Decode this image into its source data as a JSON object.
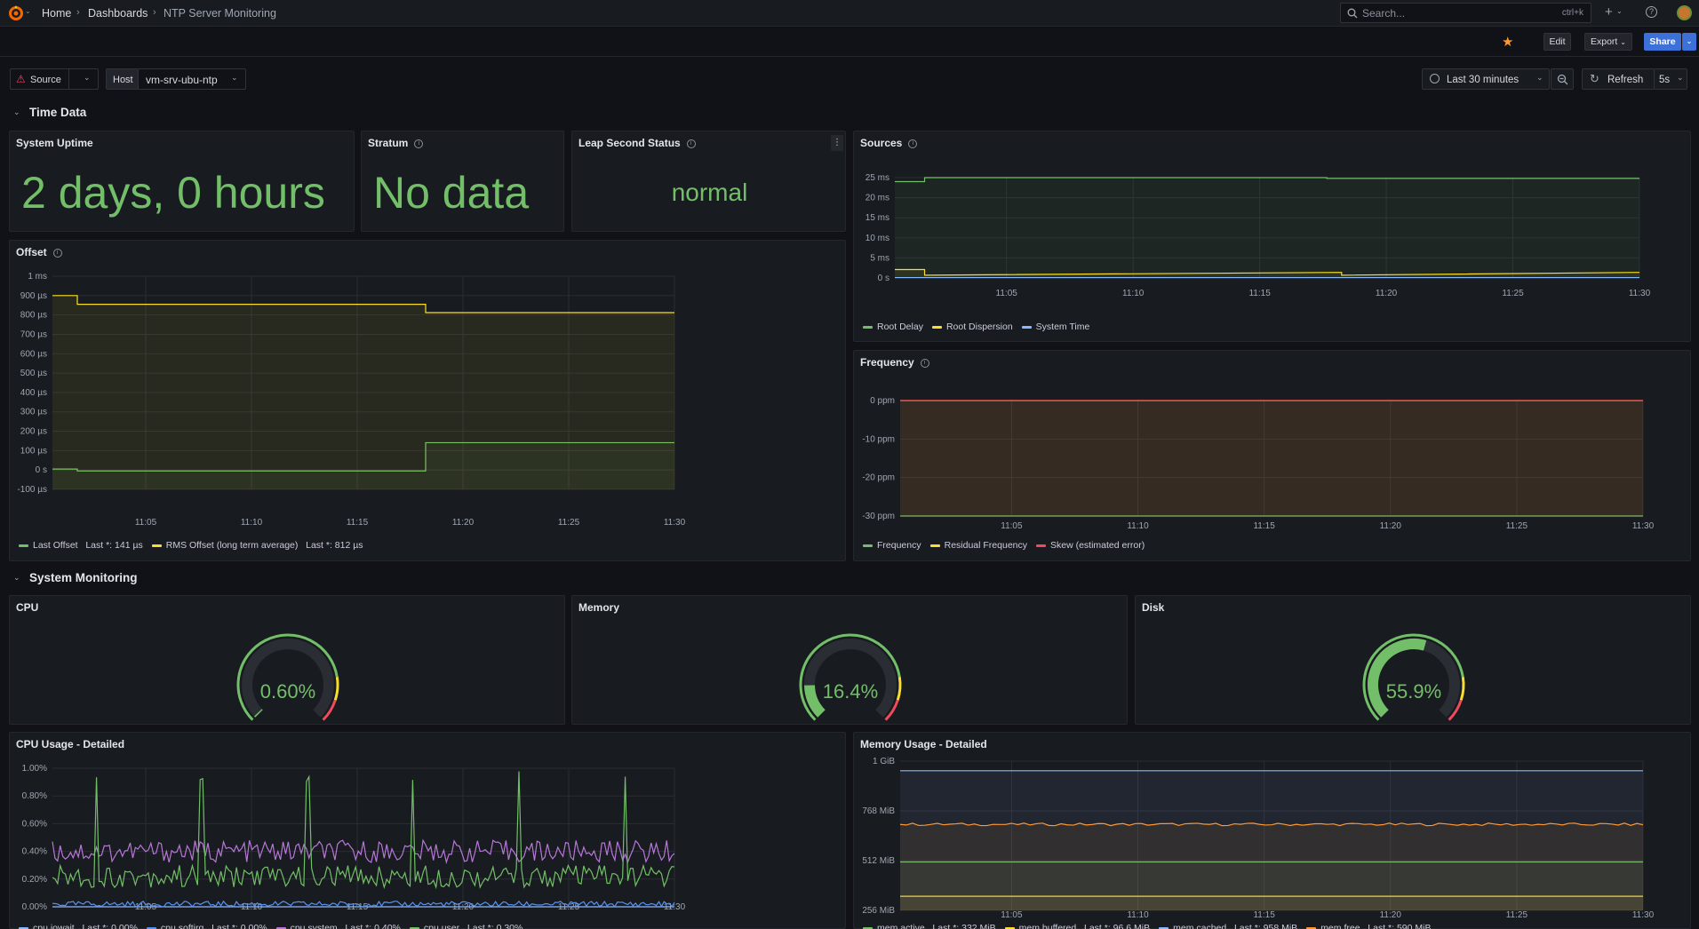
{
  "breadcrumb": [
    "Home",
    "Dashboards",
    "NTP Server Monitoring"
  ],
  "search": {
    "placeholder": "Search...",
    "shortcut": "ctrl+k"
  },
  "toolbar": {
    "edit": "Edit",
    "export": "Export",
    "share": "Share"
  },
  "variables": {
    "source_label": "Source",
    "host_label": "Host",
    "host_value": "vm-srv-ubu-ntp"
  },
  "time": {
    "range": "Last 30 minutes",
    "refresh": "Refresh",
    "interval": "5s"
  },
  "sections": {
    "time_data": "Time Data",
    "system_monitoring": "System Monitoring"
  },
  "panels": {
    "uptime": {
      "title": "System Uptime",
      "value": "2 days, 0 hours"
    },
    "stratum": {
      "title": "Stratum",
      "value": "No data"
    },
    "leap": {
      "title": "Leap Second Status",
      "value": "normal"
    },
    "sources": {
      "title": "Sources"
    },
    "offset": {
      "title": "Offset"
    },
    "frequency": {
      "title": "Frequency"
    },
    "cpu": {
      "title": "CPU",
      "value": "0.60%"
    },
    "memory": {
      "title": "Memory",
      "value": "16.4%"
    },
    "disk": {
      "title": "Disk",
      "value": "55.9%"
    },
    "cpu_detail": {
      "title": "CPU Usage - Detailed"
    },
    "mem_detail": {
      "title": "Memory Usage - Detailed"
    }
  },
  "colors": {
    "green": "#73bf69",
    "yellow": "#fade2a",
    "blue": "#8ab8ff",
    "red": "#f2495c",
    "purple": "#b877d9",
    "orange": "#ff9830",
    "lightblue": "#5794f2"
  },
  "chart_data": [
    {
      "id": "sources",
      "type": "line",
      "x_ticks": [
        "11:05",
        "11:10",
        "11:15",
        "11:20",
        "11:25",
        "11:30"
      ],
      "y_ticks": [
        "25 ms",
        "20 ms",
        "15 ms",
        "10 ms",
        "5 ms",
        "0 s"
      ],
      "ylim": [
        0,
        25
      ],
      "series": [
        {
          "name": "Root Delay",
          "color": "#73bf69",
          "x": [
            0,
            0.04,
            0.04,
            0.58,
            0.58,
            1
          ],
          "y": [
            24,
            24,
            25,
            25,
            24.8,
            24.8
          ]
        },
        {
          "name": "Root Dispersion",
          "color": "#fade2a",
          "x": [
            0,
            0.04,
            0.04,
            0.6,
            0.6,
            1
          ],
          "y": [
            2.1,
            2.1,
            0.7,
            1.4,
            0.7,
            1.4
          ]
        },
        {
          "name": "System Time",
          "color": "#8ab8ff",
          "x": [
            0,
            1
          ],
          "y": [
            0.1,
            0.1
          ]
        }
      ]
    },
    {
      "id": "offset",
      "type": "line",
      "x_ticks": [
        "11:05",
        "11:10",
        "11:15",
        "11:20",
        "11:25",
        "11:30"
      ],
      "y_ticks": [
        "1 ms",
        "900 µs",
        "800 µs",
        "700 µs",
        "600 µs",
        "500 µs",
        "400 µs",
        "300 µs",
        "200 µs",
        "100 µs",
        "0 s",
        "-100 µs"
      ],
      "ylim": [
        -100,
        1000
      ],
      "series": [
        {
          "name": "Last Offset",
          "last": "Last *: 141 µs",
          "color": "#73bf69",
          "x": [
            0,
            0.04,
            0.04,
            0.6,
            0.6,
            1
          ],
          "y": [
            5,
            5,
            -5,
            -5,
            141,
            141
          ]
        },
        {
          "name": "RMS Offset (long term average)",
          "last": "Last *: 812 µs",
          "color": "#fade2a",
          "x": [
            0,
            0.04,
            0.04,
            0.6,
            0.6,
            1
          ],
          "y": [
            900,
            900,
            855,
            855,
            812,
            812
          ]
        }
      ]
    },
    {
      "id": "frequency",
      "type": "line",
      "x_ticks": [
        "11:05",
        "11:10",
        "11:15",
        "11:20",
        "11:25",
        "11:30"
      ],
      "y_ticks": [
        "0 ppm",
        "-10 ppm",
        "-20 ppm",
        "-30 ppm"
      ],
      "ylim": [
        -30,
        0
      ],
      "series": [
        {
          "name": "Frequency",
          "color": "#73bf69",
          "x": [
            0,
            1
          ],
          "y": [
            -30,
            -30
          ]
        },
        {
          "name": "Residual Frequency",
          "color": "#fade2a",
          "x": [
            0,
            1
          ],
          "y": [
            0,
            0
          ]
        },
        {
          "name": "Skew (estimated error)",
          "color": "#f2495c",
          "x": [
            0,
            1
          ],
          "y": [
            0,
            0
          ]
        }
      ]
    },
    {
      "id": "cpu_detail",
      "type": "line",
      "x_ticks": [
        "11:05",
        "11:10",
        "11:15",
        "11:20",
        "11:25",
        "11:30"
      ],
      "y_ticks": [
        "1.00%",
        "0.80%",
        "0.60%",
        "0.40%",
        "0.20%",
        "0.00%"
      ],
      "ylim": [
        0,
        1
      ],
      "series": [
        {
          "name": "cpu.iowait",
          "last": "Last *: 0.00%",
          "color": "#8ab8ff",
          "base": 0.0,
          "spread": 0.0
        },
        {
          "name": "cpu.softirq",
          "last": "Last *: 0.00%",
          "color": "#5794f2",
          "base": 0.02,
          "spread": 0.02
        },
        {
          "name": "cpu.system",
          "last": "Last *: 0.40%",
          "color": "#b877d9",
          "base": 0.4,
          "spread": 0.08
        },
        {
          "name": "cpu.user",
          "last": "Last *: 0.30%",
          "color": "#73bf69",
          "base": 0.22,
          "spread": 0.08,
          "spikes": [
            0.07,
            0.24,
            0.41,
            0.58,
            0.75,
            0.92
          ]
        }
      ]
    },
    {
      "id": "mem_detail",
      "type": "area",
      "x_ticks": [
        "11:05",
        "11:10",
        "11:15",
        "11:20",
        "11:25",
        "11:30"
      ],
      "y_ticks": [
        "1 GiB",
        "768 MiB",
        "512 MiB",
        "256 MiB"
      ],
      "ylim": [
        0,
        1024
      ],
      "series": [
        {
          "name": "mem.active",
          "last": "Last *: 332 MiB",
          "color": "#73bf69",
          "value": 332
        },
        {
          "name": "mem.buffered",
          "last": "Last *: 96.6 MiB",
          "color": "#fade2a",
          "value": 96.6
        },
        {
          "name": "mem.cached",
          "last": "Last *: 958 MiB",
          "color": "#8ab8ff",
          "value": 958
        },
        {
          "name": "mem.free",
          "last": "Last *: 590 MiB",
          "color": "#ff9830",
          "value": 590
        }
      ]
    }
  ]
}
